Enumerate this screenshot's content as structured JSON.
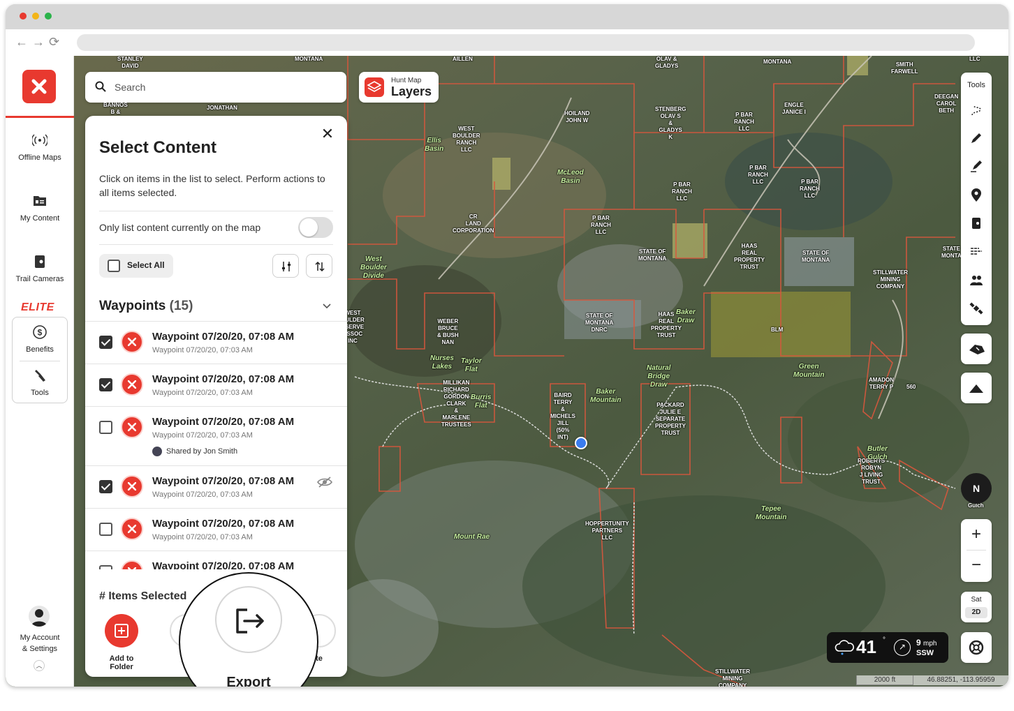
{
  "left_rail": {
    "items": [
      {
        "label": "Offline Maps",
        "icon": "offline-maps-icon"
      },
      {
        "label": "My Content",
        "icon": "my-content-icon"
      },
      {
        "label": "Trail Cameras",
        "icon": "trail-camera-icon"
      }
    ],
    "elite_label": "ELITE",
    "elite_items": [
      {
        "label": "Benefits",
        "icon": "dollar-icon"
      },
      {
        "label": "Tools",
        "icon": "tools-icon"
      }
    ],
    "account_line1": "My Account",
    "account_line2": "& Settings"
  },
  "search": {
    "placeholder": "Search"
  },
  "layers": {
    "small": "Hunt Map",
    "big": "Layers"
  },
  "panel": {
    "title": "Select Content",
    "description": "Click on items in the list to select. Perform actions to all items selected.",
    "only_list_label": "Only list content currently on the map",
    "only_list_on": false,
    "select_all_label": "Select All",
    "section_title": "Waypoints",
    "section_count": "(15)",
    "items": [
      {
        "title": "Waypoint 07/20/20, 07:08 AM",
        "subtitle": "Waypoint 07/20/20, 07:03 AM",
        "checked": true
      },
      {
        "title": "Waypoint 07/20/20, 07:08 AM",
        "subtitle": "Waypoint 07/20/20, 07:03 AM",
        "checked": true
      },
      {
        "title": "Waypoint 07/20/20, 07:08 AM",
        "subtitle": "Waypoint 07/20/20, 07:03 AM",
        "checked": false,
        "shared": "Shared by Jon Smith"
      },
      {
        "title": "Waypoint 07/20/20, 07:08 AM",
        "subtitle": "Waypoint 07/20/20, 07:03 AM",
        "checked": true,
        "hidden": true
      },
      {
        "title": "Waypoint 07/20/20, 07:08 AM",
        "subtitle": "Waypoint 07/20/20, 07:03 AM",
        "checked": false
      },
      {
        "title": "Waypoint 07/20/20, 07:08 AM",
        "subtitle": "",
        "checked": false
      }
    ],
    "items_selected_label": "# Items Selected",
    "actions": [
      {
        "label": "Add to Folder"
      },
      {
        "label": "Sh"
      },
      {
        "label": "te"
      }
    ]
  },
  "callout": {
    "label": "Export"
  },
  "right_tools": {
    "title": "Tools",
    "icons": [
      "route-icon",
      "pencil-icon",
      "draw-icon",
      "pin-icon",
      "camera-icon",
      "wind-icon",
      "people-icon",
      "satellite-icon"
    ]
  },
  "compass_label": "N",
  "zoom": {
    "plus": "+",
    "minus": "−"
  },
  "basemap": {
    "label": "Sat",
    "mode": "2D"
  },
  "weather": {
    "temp": "41",
    "deg": "°",
    "speed": "9",
    "speed_unit": "mph",
    "direction": "SSW"
  },
  "scale_label": "2000 ft",
  "coordinates": "46.88251, -113.95959",
  "map_labels": [
    {
      "text": "STANLEY\nDAVID"
    },
    {
      "text": "MONTANA"
    },
    {
      "text": "AILLEN"
    },
    {
      "text": "OLAV &\nGLADYS"
    },
    {
      "text": "MONTANA"
    },
    {
      "text": "SMITH\nFARWELL"
    },
    {
      "text": "LLC"
    },
    {
      "text": "BANNOS\nB &"
    },
    {
      "text": "JONATHAN"
    },
    {
      "text": "HOILAND\nJOHN W"
    },
    {
      "text": "STENBERG\nOLAV S\n&\nGLADYS\nK"
    },
    {
      "text": "P BAR\nRANCH\nLLC"
    },
    {
      "text": "ENGLE\nJANICE I"
    },
    {
      "text": "DEEGAN\nCAROL\nBETH"
    },
    {
      "text": "WEST\nBOULDER\nRANCH\nLLC"
    },
    {
      "text": "Ellis\nBasin"
    },
    {
      "text": "McLeod\nBasin"
    },
    {
      "text": "P BAR\nRANCH\nLLC"
    },
    {
      "text": "P BAR\nRANCH\nLLC"
    },
    {
      "text": "P BAR\nRANCH\nLLC"
    },
    {
      "text": "CR\nLAND\nCORPORATION"
    },
    {
      "text": "P BAR\nRANCH\nLLC"
    },
    {
      "text": "STATE OF\nMONTANA"
    },
    {
      "text": "HAAS\nREAL\nPROPERTY\nTRUST"
    },
    {
      "text": "STATE OF\nMONTANA"
    },
    {
      "text": "STATE\nMONTA"
    },
    {
      "text": "STILLWATER\nMINING\nCOMPANY"
    },
    {
      "text": "West\nBoulder\nDivide"
    },
    {
      "text": "WEST\nOULDER\nESERVE\nASSOC\nINC"
    },
    {
      "text": "WEBER\nBRUCE\n& BUSH\nNAN"
    },
    {
      "text": "STATE OF\nMONTANA\nDNRC"
    },
    {
      "text": "HAAS\nREAL\nPROPERTY\nTRUST"
    },
    {
      "text": "Baker\nDraw"
    },
    {
      "text": "BLM"
    },
    {
      "text": "Nurses\nLakes"
    },
    {
      "text": "Taylor\nFlat"
    },
    {
      "text": "Green\nMountain"
    },
    {
      "text": "AMADON\nTERRY P"
    },
    {
      "text": "560"
    },
    {
      "text": "MILLIKAN\nRICHARD\nGORDON\nCLARK\n&\nMARLENE\nTRUSTEES"
    },
    {
      "text": "Burris\nFlat"
    },
    {
      "text": "BAIRD\nTERRY\n&\nMICHELS\nJILL\n(50%\nINT)"
    },
    {
      "text": "Baker\nMountain"
    },
    {
      "text": "Natural\nBridge\nDraw"
    },
    {
      "text": "PACKARD\nJULIE E\nSEPARATE\nPROPERTY\nTRUST"
    },
    {
      "text": "ROBERTS\nROBYN\nJ LIVING\nTRUST"
    },
    {
      "text": "Butler\nGulch"
    },
    {
      "text": "Tepee\nMountain"
    },
    {
      "text": "Mount Rae"
    },
    {
      "text": "HOPPERTUNITY\nPARTNERS\nLLC"
    },
    {
      "text": "STILLWATER\nMINING\nCOMPANY"
    },
    {
      "text": "Gulch"
    }
  ]
}
